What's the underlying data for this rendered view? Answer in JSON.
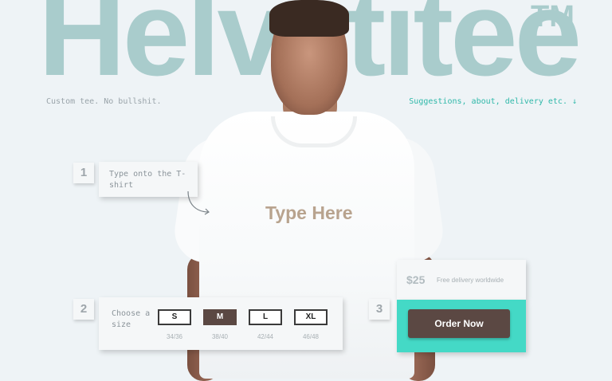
{
  "brand": {
    "title": "Helvetitee",
    "tm": "TM"
  },
  "header": {
    "tagline": "Custom tee. No bullshit.",
    "link": "Suggestions, about, delivery etc.",
    "link_arrow": "↓"
  },
  "shirt": {
    "placeholder_text": "Type Here"
  },
  "step1": {
    "number": "1",
    "text": "Type onto the T-shirt"
  },
  "step2": {
    "number": "2",
    "label": "Choose a size",
    "selected": "M",
    "sizes": [
      {
        "label": "S",
        "measure": "34/36"
      },
      {
        "label": "M",
        "measure": "38/40"
      },
      {
        "label": "L",
        "measure": "42/44"
      },
      {
        "label": "XL",
        "measure": "46/48"
      }
    ]
  },
  "step3": {
    "number": "3",
    "price": "$25",
    "delivery": "Free delivery worldwide",
    "order_label": "Order Now"
  },
  "colors": {
    "accent": "#44d9c6",
    "button": "#5b4843",
    "brand_bg_text": "#a9cccc",
    "link": "#2fb8a9"
  }
}
